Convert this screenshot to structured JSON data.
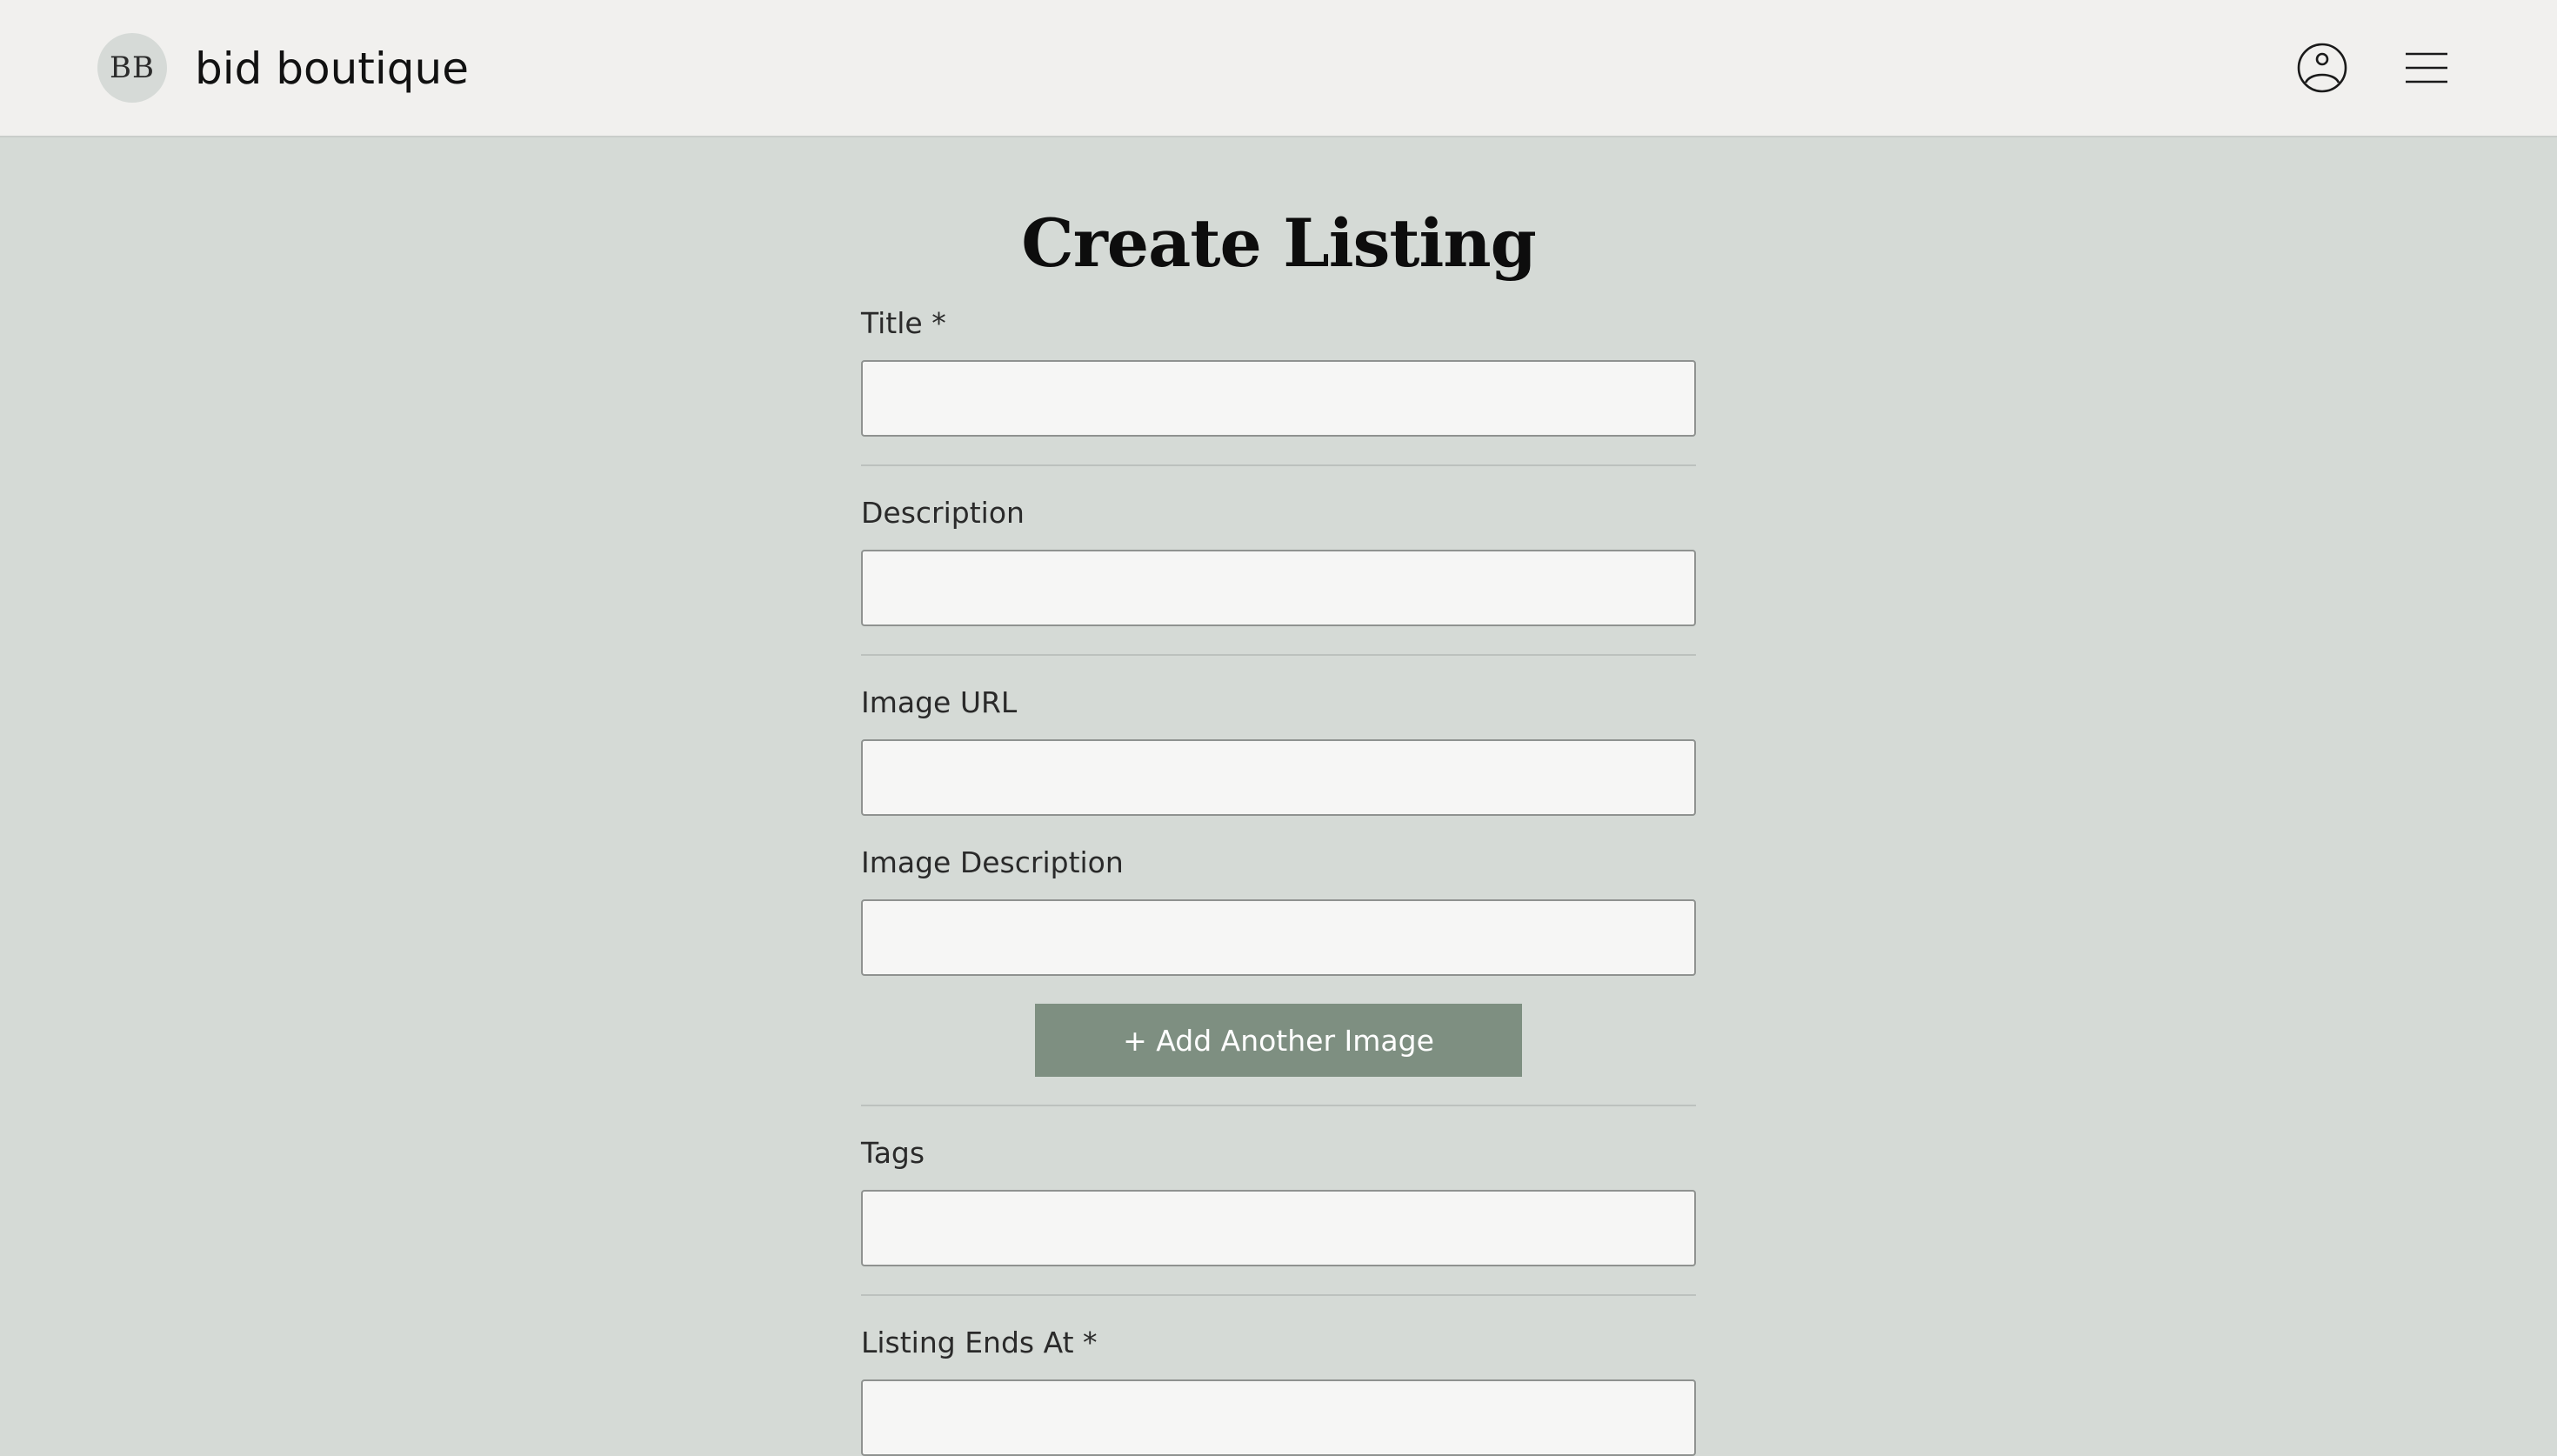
{
  "header": {
    "logo_initials": "BB",
    "brand_name": "bid boutique"
  },
  "page": {
    "title": "Create Listing"
  },
  "form": {
    "title_label": "Title *",
    "title_value": "",
    "description_label": "Description",
    "description_value": "",
    "image_url_label": "Image URL",
    "image_url_value": "",
    "image_description_label": "Image Description",
    "image_description_value": "",
    "add_image_button": "+ Add Another Image",
    "tags_label": "Tags",
    "tags_value": "",
    "ends_at_label": "Listing Ends At *"
  },
  "colors": {
    "header_bg": "#f1f0ee",
    "page_bg": "#d5dad6",
    "button_bg": "#7e8f81",
    "field_bg": "#f6f6f5"
  },
  "icons": {
    "account": "user-circle-icon",
    "menu": "hamburger-menu-icon"
  }
}
